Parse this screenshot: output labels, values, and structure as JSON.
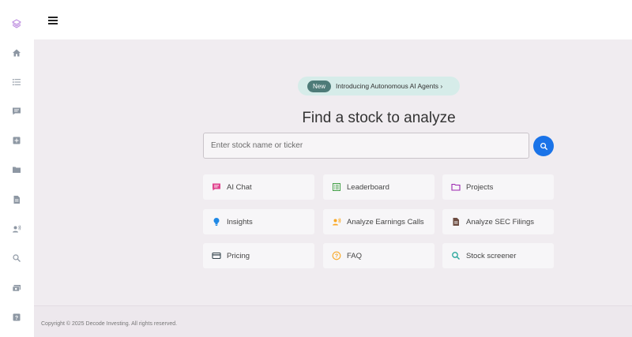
{
  "sidebar": {
    "items": [
      {
        "icon": "layers-icon"
      },
      {
        "icon": "home-icon"
      },
      {
        "icon": "list-icon"
      },
      {
        "icon": "chat-icon"
      },
      {
        "icon": "add-box-icon"
      },
      {
        "icon": "folder-icon"
      },
      {
        "icon": "document-icon"
      },
      {
        "icon": "voice-user-icon"
      },
      {
        "icon": "search-icon"
      },
      {
        "icon": "money-icon"
      },
      {
        "icon": "help-icon"
      }
    ]
  },
  "header": {
    "menu_icon": "hamburger-icon"
  },
  "announcement": {
    "badge": "New",
    "text": "Introducing Autonomous AI Agents ›"
  },
  "main": {
    "title": "Find a stock to analyze",
    "search_placeholder": "Enter stock name or ticker",
    "search_value": ""
  },
  "cards": [
    {
      "label": "AI Chat",
      "icon": "chat-icon",
      "color": "#e0458f"
    },
    {
      "label": "Leaderboard",
      "icon": "leaderboard-icon",
      "color": "#43a047"
    },
    {
      "label": "Projects",
      "icon": "folder-icon",
      "color": "#9c27b0"
    },
    {
      "label": "Insights",
      "icon": "lightbulb-icon",
      "color": "#1e88e5"
    },
    {
      "label": "Analyze Earnings Calls",
      "icon": "voice-user-icon",
      "color": "#f9a825"
    },
    {
      "label": "Analyze SEC Filings",
      "icon": "document-icon",
      "color": "#6d4c41"
    },
    {
      "label": "Pricing",
      "icon": "credit-card-icon",
      "color": "#37474f"
    },
    {
      "label": "FAQ",
      "icon": "help-circle-icon",
      "color": "#f9a825"
    },
    {
      "label": "Stock screener",
      "icon": "search-icon",
      "color": "#26a69a"
    }
  ],
  "footer": {
    "copyright": "Copyright © 2025 Decode Investing. All rights reserved."
  },
  "colors": {
    "accent": "#1a73e8",
    "background": "#f0ecf0",
    "badge": "#4e7b78"
  }
}
